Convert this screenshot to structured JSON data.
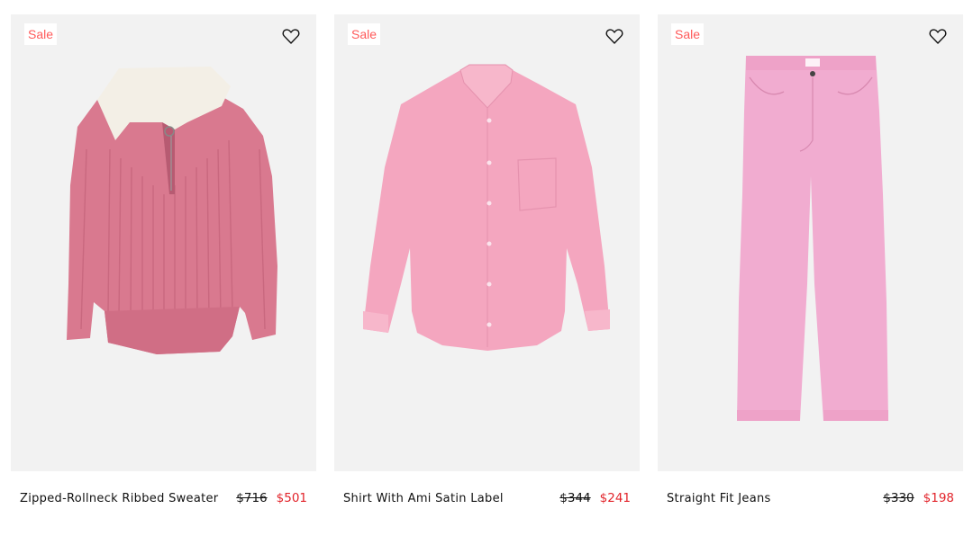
{
  "colors": {
    "card_background": "#f2f2f2",
    "sale_text": "#ff5a5a",
    "sale_price": "#e2232a",
    "text": "#111111",
    "sweater_pink": "#d9798f",
    "sweater_collar": "#f3efe6",
    "shirt_pink": "#f4a6bf",
    "jeans_pink": "#f1acd0"
  },
  "products": [
    {
      "badge": "Sale",
      "wishlist_icon": "heart-outline-icon",
      "image_subject": "sweater",
      "name": "Zipped-Rollneck Ribbed Sweater",
      "old_price": "$716",
      "sale_price": "$501"
    },
    {
      "badge": "Sale",
      "wishlist_icon": "heart-outline-icon",
      "image_subject": "shirt",
      "name": "Shirt With Ami Satin Label",
      "old_price": "$344",
      "sale_price": "$241"
    },
    {
      "badge": "Sale",
      "wishlist_icon": "heart-outline-icon",
      "image_subject": "jeans",
      "name": "Straight Fit Jeans",
      "old_price": "$330",
      "sale_price": "$198"
    }
  ]
}
